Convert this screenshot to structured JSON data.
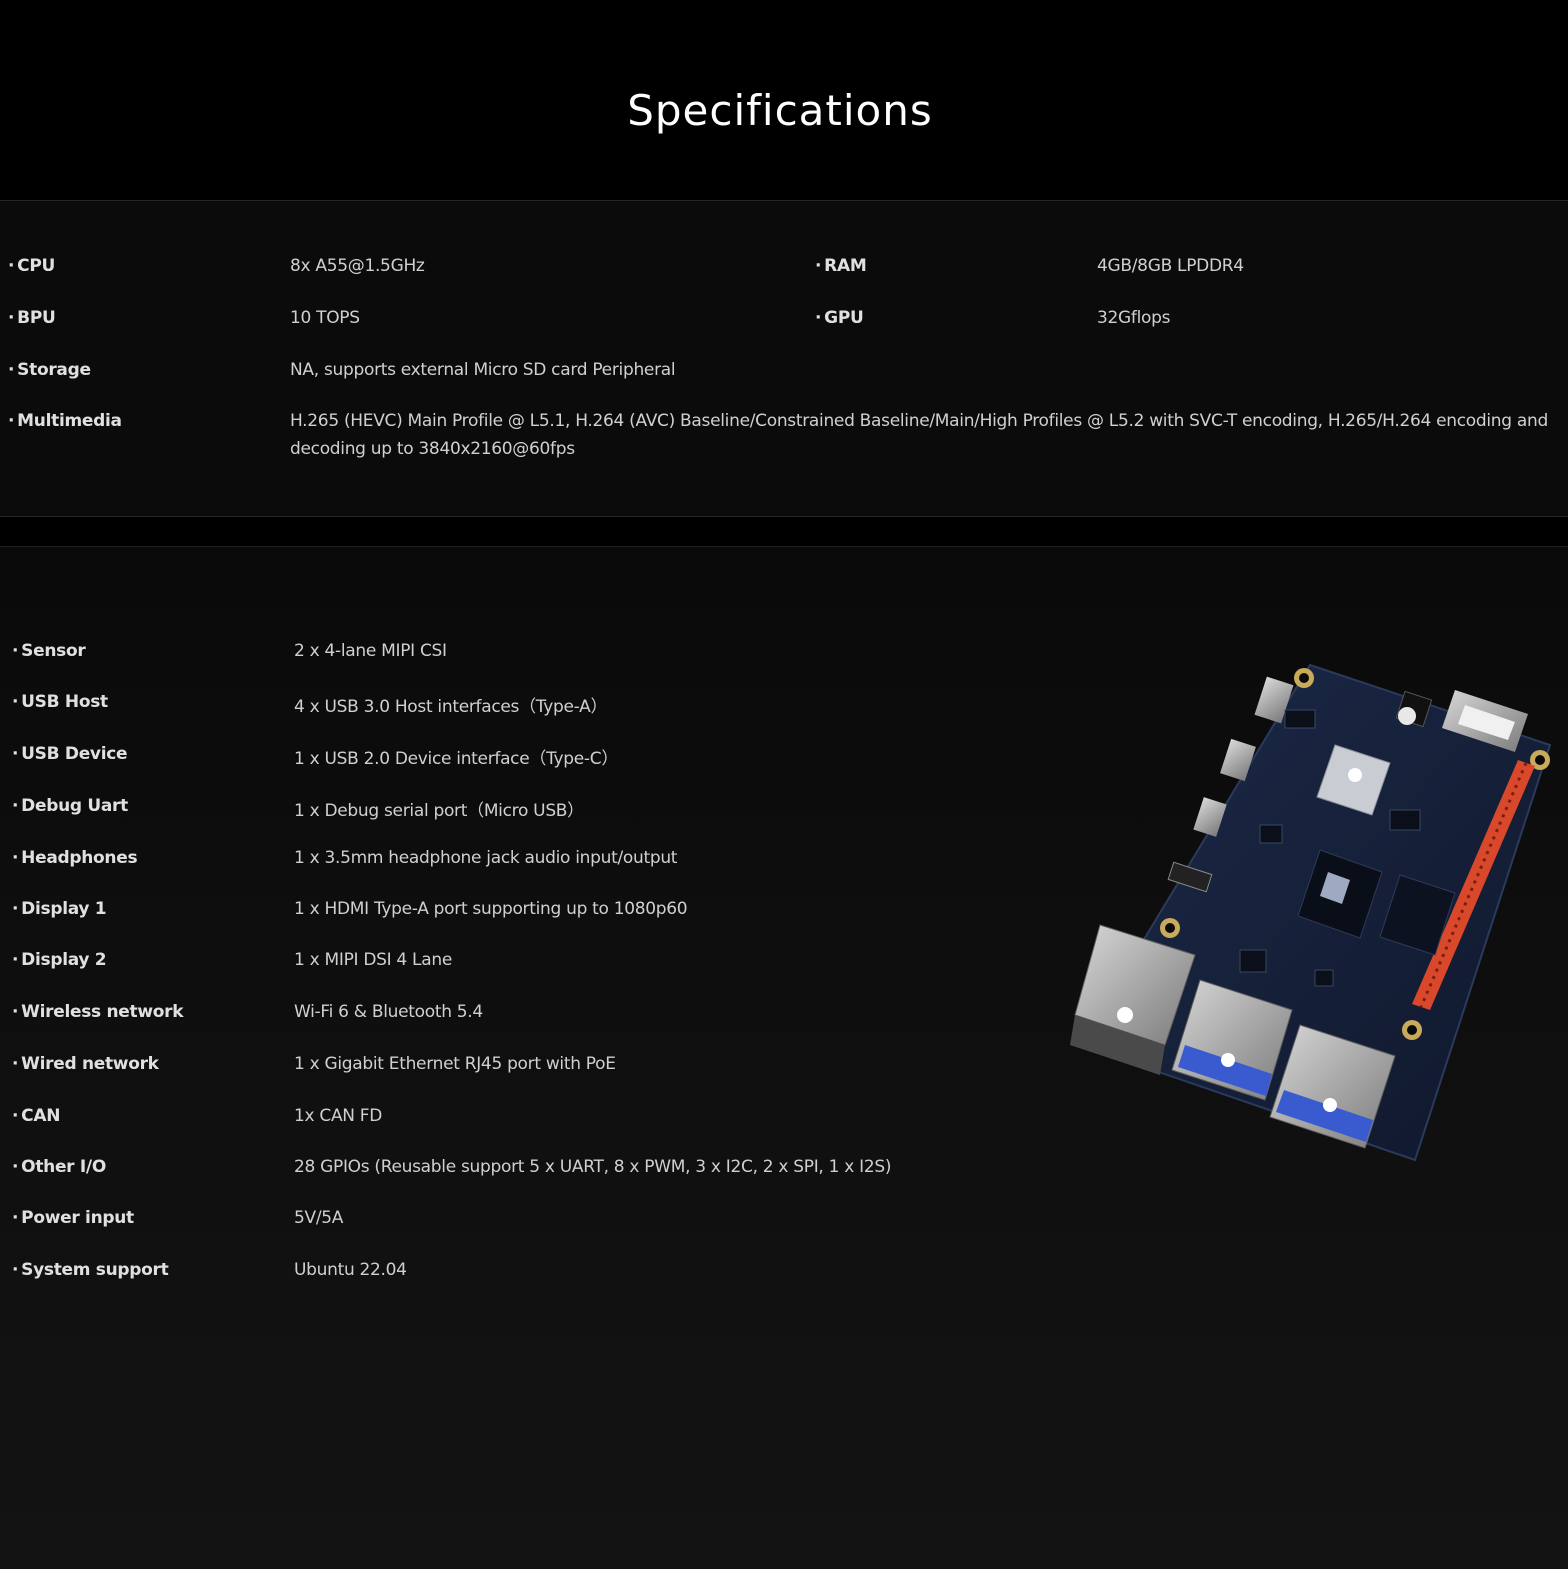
{
  "page": {
    "title": "Specifications"
  },
  "top_specs": {
    "cpu": {
      "label": "CPU",
      "value": "8x A55@1.5GHz"
    },
    "ram": {
      "label": "RAM",
      "value": "4GB/8GB LPDDR4"
    },
    "bpu": {
      "label": "BPU",
      "value": "10 TOPS"
    },
    "gpu": {
      "label": "GPU",
      "value": "32Gflops"
    },
    "storage": {
      "label": "Storage",
      "value": "NA, supports external Micro SD card Peripheral"
    },
    "multimedia": {
      "label": "Multimedia",
      "value": "H.265 (HEVC) Main Profile @ L5.1, H.264 (AVC) Baseline/Constrained Baseline/Main/High Profiles @ L5.2 with SVC-T encoding, H.265/H.264 encoding and decoding up to 3840x2160@60fps"
    }
  },
  "bottom_specs": [
    {
      "label": "Sensor",
      "value": "2 x 4-lane MIPI CSI"
    },
    {
      "label": "USB Host",
      "value": "4 x USB 3.0 Host interfaces（Type-A）"
    },
    {
      "label": "USB Device",
      "value": "1 x USB 2.0 Device interface（Type-C）"
    },
    {
      "label": "Debug Uart",
      "value": "1 x Debug serial port（Micro USB）"
    },
    {
      "label": "Headphones",
      "value": "1 x 3.5mm headphone jack audio input/output"
    },
    {
      "label": "Display 1",
      "value": "1 x HDMI Type-A port supporting up to 1080p60"
    },
    {
      "label": "Display 2",
      "value": "1 x MIPI DSI 4 Lane"
    },
    {
      "label": "Wireless network",
      "value": "Wi-Fi 6 & Bluetooth 5.4"
    },
    {
      "label": "Wired network",
      "value": "1 x Gigabit Ethernet RJ45 port with PoE"
    },
    {
      "label": "CAN",
      "value": "1x CAN FD"
    },
    {
      "label": "Other I/O",
      "value": "28 GPIOs (Reusable support 5 x UART, 8 x PWM, 3 x I2C, 2 x SPI, 1 x I2S)"
    },
    {
      "label": "Power input",
      "value": "5V/5A"
    },
    {
      "label": "System support",
      "value": "Ubuntu 22.04"
    }
  ],
  "colors": {
    "background": "#000000",
    "title": "#ffffff",
    "label": "#e0e0e0",
    "value": "#d0d0d0",
    "board": "#17233c",
    "header_pins": "#d9482b"
  },
  "image": {
    "icon": "development-board-image"
  }
}
